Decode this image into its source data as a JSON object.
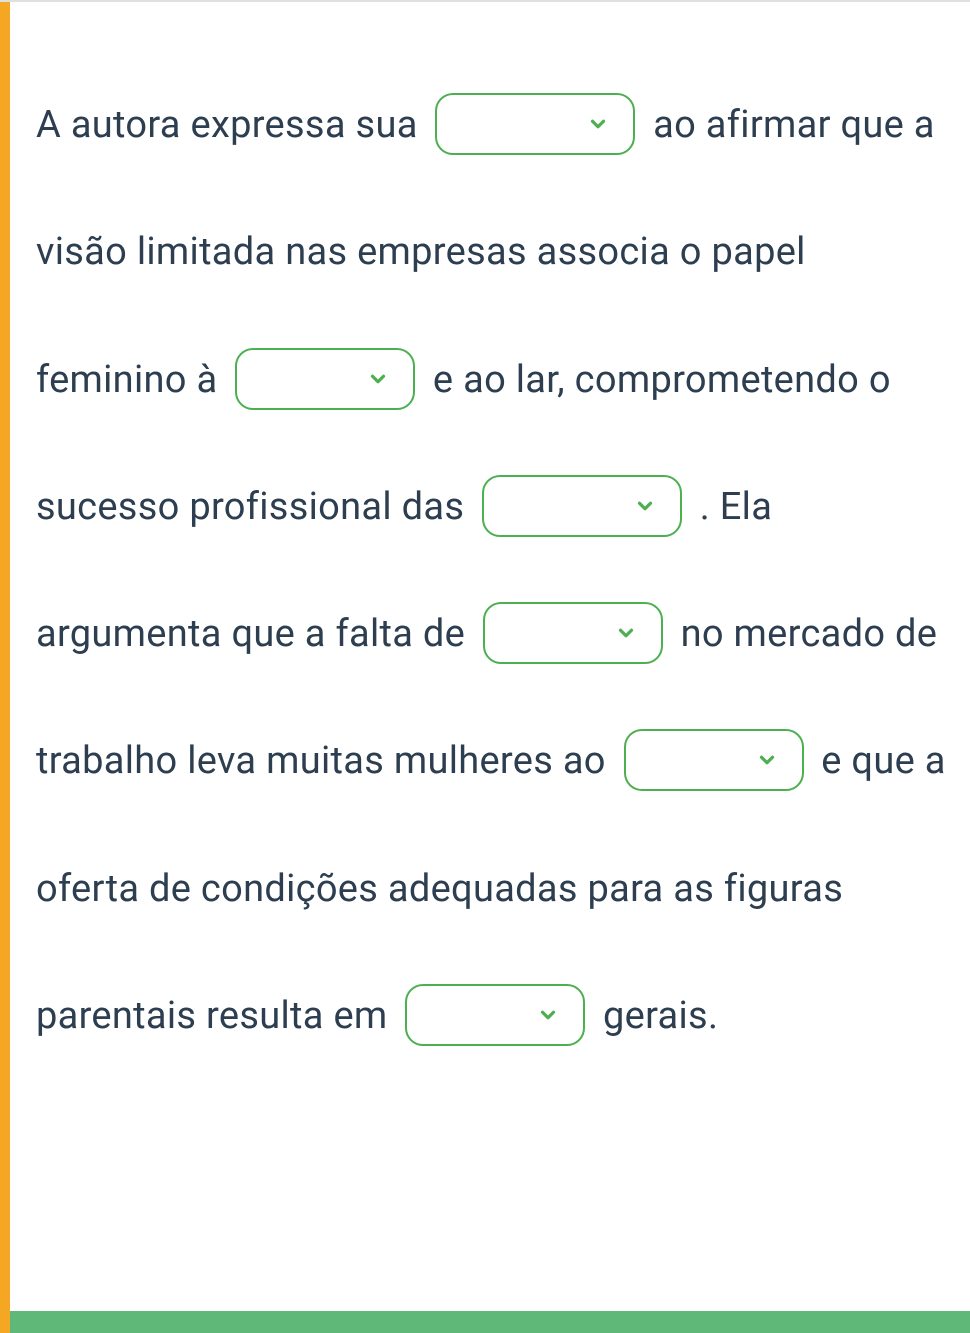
{
  "exercise": {
    "segments": {
      "s1": "A autora expressa sua ",
      "s2": " ao afirmar que a visão limitada nas empresas associa o papel feminino à ",
      "s3": " e ao lar, comprometendo o sucesso profissional das ",
      "s4": ". Ela argumenta que a falta de ",
      "s5": " no mercado de trabalho leva muitas mulheres ao ",
      "s6": " e que a oferta de condições adequadas para as figuras parentais resulta em ",
      "s7": " gerais."
    },
    "blanks": {
      "b1": "",
      "b2": "",
      "b3": "",
      "b4": "",
      "b5": "",
      "b6": ""
    }
  },
  "colors": {
    "accent": "#f5a623",
    "dropdown_border": "#4caf50",
    "text": "#2c3e50",
    "bottom": "#5fb878"
  }
}
